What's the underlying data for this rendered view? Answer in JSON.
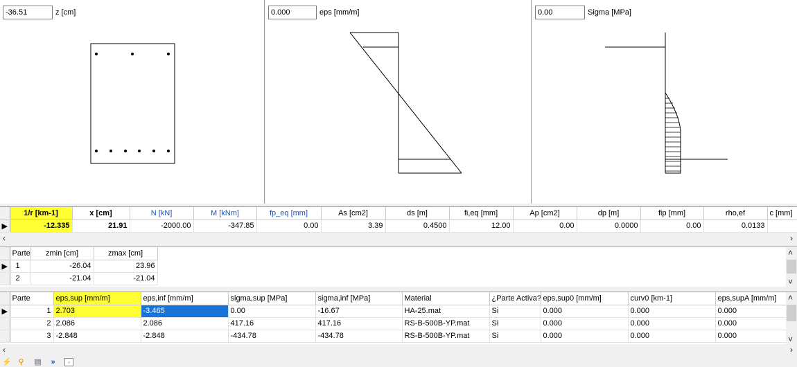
{
  "panels": {
    "z": {
      "value": "-36.51",
      "unit": "z [cm]"
    },
    "eps": {
      "value": "0.000",
      "unit": "eps [mm/m]"
    },
    "sigma": {
      "value": "0.00",
      "unit": "Sigma [MPa]"
    }
  },
  "results": {
    "headers": [
      "1/r [km-1]",
      "x [cm]",
      "N [kN]",
      "M [kNm]",
      "fp_eq [mm]",
      "As [cm2]",
      "ds [m]",
      "fi,eq [mm]",
      "Ap [cm2]",
      "dp [m]",
      "fip [mm]",
      "rho,ef",
      "c [mm]"
    ],
    "row": [
      "-12.335",
      "21.91",
      "-2000.00",
      "-347.85",
      "0.00",
      "3.39",
      "0.4500",
      "12.00",
      "0.00",
      "0.0000",
      "0.00",
      "0.0133",
      ""
    ]
  },
  "parts": {
    "headers": [
      "Parte",
      "zmin [cm]",
      "zmax [cm]"
    ],
    "rows": [
      [
        "1",
        "-26.04",
        "23.96"
      ],
      [
        "2",
        "-21.04",
        "-21.04"
      ]
    ]
  },
  "layers": {
    "headers": [
      "Parte",
      "eps,sup [mm/m]",
      "eps,inf [mm/m]",
      "sigma,sup [MPa]",
      "sigma,inf [MPa]",
      "Material",
      "¿Parte Activa?",
      "eps,sup0 [mm/m]",
      "curv0 [km-1]",
      "eps,supA [mm/m]"
    ],
    "rows": [
      [
        "1",
        "2.703",
        "-3.465",
        "0.00",
        "-16.67",
        "HA-25.mat",
        "Si",
        "0.000",
        "0.000",
        "0.000"
      ],
      [
        "2",
        "2.086",
        "2.086",
        "417.16",
        "417.16",
        "RS-B-500B-YP.mat",
        "Si",
        "0.000",
        "0.000",
        "0.000"
      ],
      [
        "3",
        "-2.848",
        "-2.848",
        "-434.78",
        "-434.78",
        "RS-B-500B-YP.mat",
        "Si",
        "0.000",
        "0.000",
        "0.000"
      ]
    ]
  },
  "icons": [
    "lightning-icon",
    "zoom-icon",
    "print-icon",
    "forward-icon",
    "page-icon"
  ],
  "colors": {
    "highlight": "#ffff33",
    "selection": "#1a73d9",
    "header_blue": "#1c54b8"
  }
}
